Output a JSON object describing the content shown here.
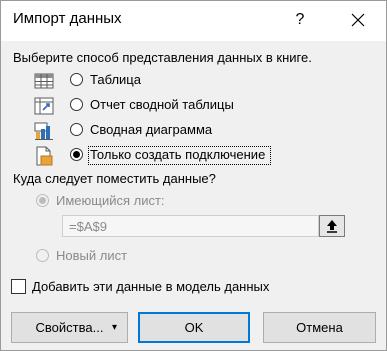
{
  "window": {
    "title": "Импорт данных",
    "help_glyph": "?"
  },
  "view_group": {
    "prompt": "Выберите способ представления данных в книге.",
    "options": [
      {
        "label": "Таблица",
        "selected": false,
        "icon": "table-icon"
      },
      {
        "label": "Отчет сводной таблицы",
        "selected": false,
        "icon": "pivot-table-icon"
      },
      {
        "label": "Сводная диаграмма",
        "selected": false,
        "icon": "pivot-chart-icon"
      },
      {
        "label": "Только создать подключение",
        "selected": true,
        "icon": "connection-only-icon"
      }
    ]
  },
  "destination_group": {
    "prompt": "Куда следует поместить данные?",
    "existing_sheet_label": "Имеющийся лист:",
    "cell_reference": "=$A$9",
    "new_sheet_label": "Новый лист",
    "enabled": false
  },
  "data_model": {
    "label": "Добавить эти данные в модель данных",
    "checked": false
  },
  "buttons": {
    "properties": "Свойства...",
    "dropdown_glyph": "▾",
    "ok": "OK",
    "cancel": "Отмена"
  },
  "colors": {
    "accent": "#0078d7",
    "disabled": "#8a8a8a",
    "background": "#f0f0f0"
  }
}
